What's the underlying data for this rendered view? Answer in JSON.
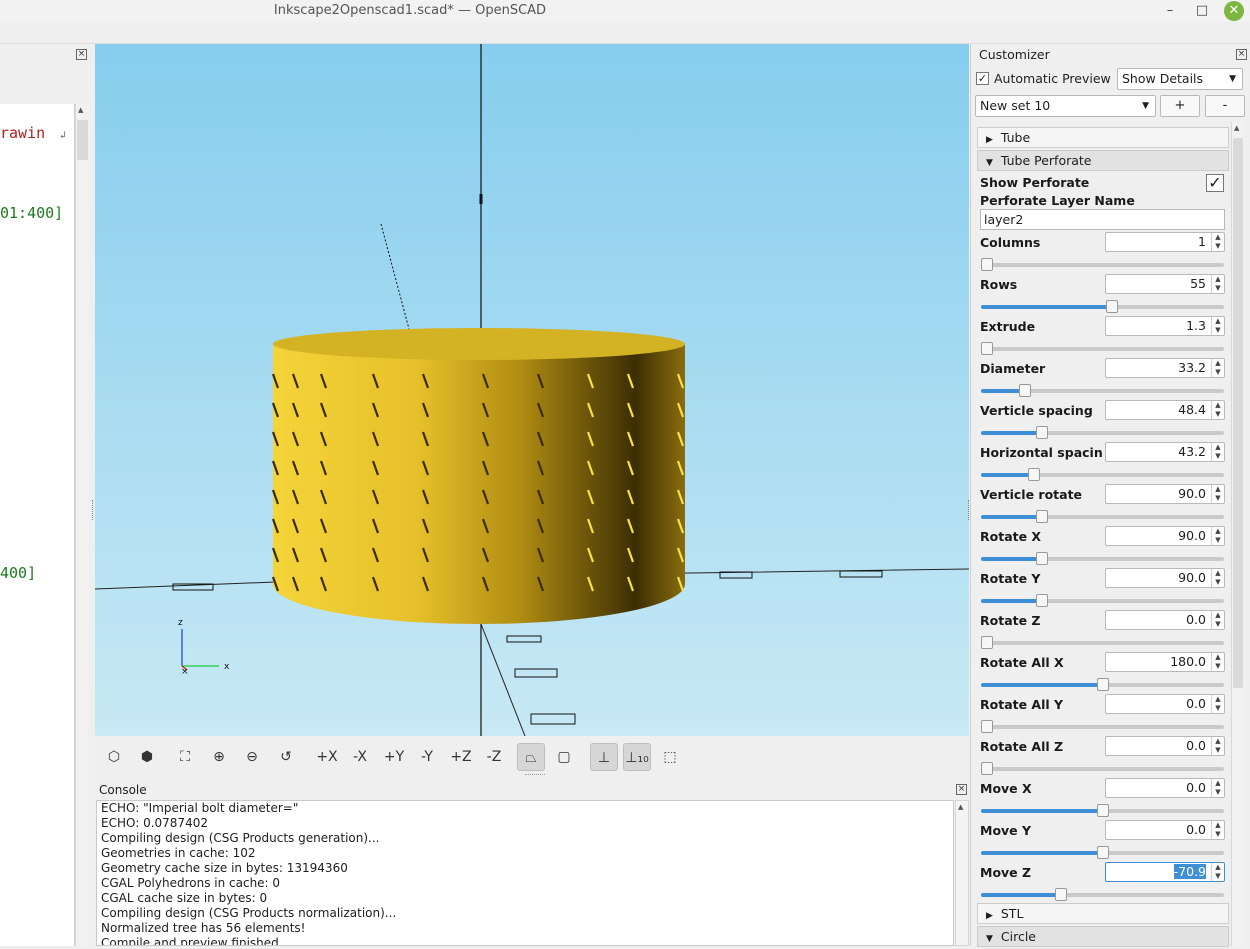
{
  "window": {
    "title": "Inkscape2Openscad1.scad* — OpenSCAD",
    "minimize": "–",
    "maximize": "□",
    "close": "✕"
  },
  "editor": {
    "line1": "rawin",
    "line2": "01:400]",
    "line3": "400]"
  },
  "viewport": {
    "axis_z": "z",
    "axis_x": "x"
  },
  "toolbar": {
    "buttons": [
      {
        "name": "preview-button",
        "glyph": "⬡"
      },
      {
        "name": "render-button",
        "glyph": "⬢"
      },
      {
        "name": "view-all-button",
        "glyph": "⛶"
      },
      {
        "name": "zoom-in-button",
        "glyph": "⊕"
      },
      {
        "name": "zoom-out-button",
        "glyph": "⊖"
      },
      {
        "name": "reset-view-button",
        "glyph": "↺"
      },
      {
        "name": "view-right-button",
        "glyph": "+X"
      },
      {
        "name": "view-left-button",
        "glyph": "-X"
      },
      {
        "name": "view-back-button",
        "glyph": "+Y"
      },
      {
        "name": "view-front-button",
        "glyph": "-Y"
      },
      {
        "name": "view-top-button",
        "glyph": "+Z"
      },
      {
        "name": "view-bottom-button",
        "glyph": "-Z"
      },
      {
        "name": "perspective-button",
        "glyph": "⏢"
      },
      {
        "name": "orthogonal-button",
        "glyph": "▢"
      },
      {
        "name": "show-axes-button",
        "glyph": "⊥"
      },
      {
        "name": "show-scale-button",
        "glyph": "⊥₁₀"
      },
      {
        "name": "show-edges-button",
        "glyph": "⬚"
      }
    ]
  },
  "console": {
    "title": "Console",
    "lines": [
      "ECHO: \"Imperial bolt diameter=\"",
      "ECHO: 0.0787402",
      "Compiling design (CSG Products generation)...",
      "Geometries in cache: 102",
      "Geometry cache size in bytes: 13194360",
      "CGAL Polyhedrons in cache: 0",
      "CGAL cache size in bytes: 0",
      "Compiling design (CSG Products normalization)...",
      "Normalized tree has 56 elements!",
      "Compile and preview finished."
    ]
  },
  "customizer": {
    "title": "Customizer",
    "auto_preview_label": "Automatic Preview",
    "auto_preview_checked": true,
    "details_select": "Show Details",
    "preset_select": "New set 10",
    "add_label": "+",
    "remove_label": "-",
    "groups": {
      "tube": "Tube",
      "tube_perforate": "Tube Perforate",
      "stl": "STL",
      "circle": "Circle"
    },
    "show_perforate_label": "Show Perforate",
    "layer_name_label": "Perforate Layer Name",
    "layer_name_value": "layer2",
    "params": [
      {
        "label": "Columns",
        "value": "1",
        "level": 0.0
      },
      {
        "label": "Rows",
        "value": "55",
        "level": 0.54
      },
      {
        "label": "Extrude",
        "value": "1.3",
        "level": 0.01
      },
      {
        "label": "Diameter",
        "value": "33.2",
        "level": 0.18
      },
      {
        "label": "Verticle spacing",
        "value": "48.4",
        "level": 0.25
      },
      {
        "label": "Horizontal spacing",
        "value": "43.2",
        "level": 0.22
      },
      {
        "label": "Verticle rotate",
        "value": "90.0",
        "level": 0.25
      },
      {
        "label": "Rotate X",
        "value": "90.0",
        "level": 0.25
      },
      {
        "label": "Rotate Y",
        "value": "90.0",
        "level": 0.25
      },
      {
        "label": "Rotate Z",
        "value": "0.0",
        "level": 0.0
      },
      {
        "label": "Rotate All X",
        "value": "180.0",
        "level": 0.5
      },
      {
        "label": "Rotate All Y",
        "value": "0.0",
        "level": 0.0
      },
      {
        "label": "Rotate All Z",
        "value": "0.0",
        "level": 0.0
      },
      {
        "label": "Move X",
        "value": "0.0",
        "level": 0.5
      },
      {
        "label": "Move Y",
        "value": "0.0",
        "level": 0.5
      },
      {
        "label": "Move Z",
        "value": "-70.9",
        "level": 0.33
      }
    ]
  }
}
